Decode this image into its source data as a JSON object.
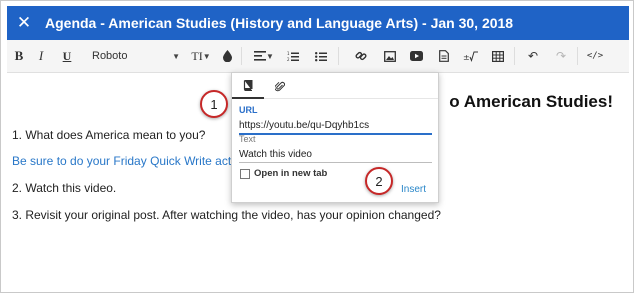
{
  "dialog": {
    "title": "Agenda - American Studies (History and Language Arts) - Jan 30, 2018",
    "close_glyph": "✕"
  },
  "toolbar": {
    "bold": "B",
    "italic": "I",
    "underline": "U",
    "font_name": "Roboto",
    "size_glyph": "TI",
    "undo_glyph": "↶",
    "redo_glyph": "↷",
    "code_glyph": "</>",
    "icons": [
      "bold-icon",
      "italic-icon",
      "underline-icon",
      "font-select",
      "text-size-icon",
      "text-color-icon",
      "align-icon",
      "ordered-list-icon",
      "unordered-list-icon",
      "link-icon",
      "image-icon",
      "video-icon",
      "document-icon",
      "math-icon",
      "table-icon",
      "undo-icon",
      "redo-icon",
      "code-view-icon"
    ]
  },
  "content": {
    "heading": "o American Studies!",
    "line1": "1. What does America mean to you?",
    "line2": "Be sure to do your Friday Quick Write activit",
    "line3": "2. Watch this video.",
    "line4": "3. Revisit your original post. After watching the video, has your opinion changed?"
  },
  "link_popup": {
    "tabs": [
      "book-icon",
      "paperclip-icon"
    ],
    "url_label": "URL",
    "url_value": "https://youtu.be/qu-Dqyhb1cs",
    "text_label": "Text",
    "text_value": "Watch this video",
    "new_tab_label": "Open in new tab",
    "insert_label": "Insert"
  },
  "callouts": [
    "1",
    "2"
  ],
  "colors": {
    "title_bar": "#1f63c6",
    "link_text": "#2877c8",
    "insert": "#2a87c9",
    "callout_border": "#c62828"
  }
}
